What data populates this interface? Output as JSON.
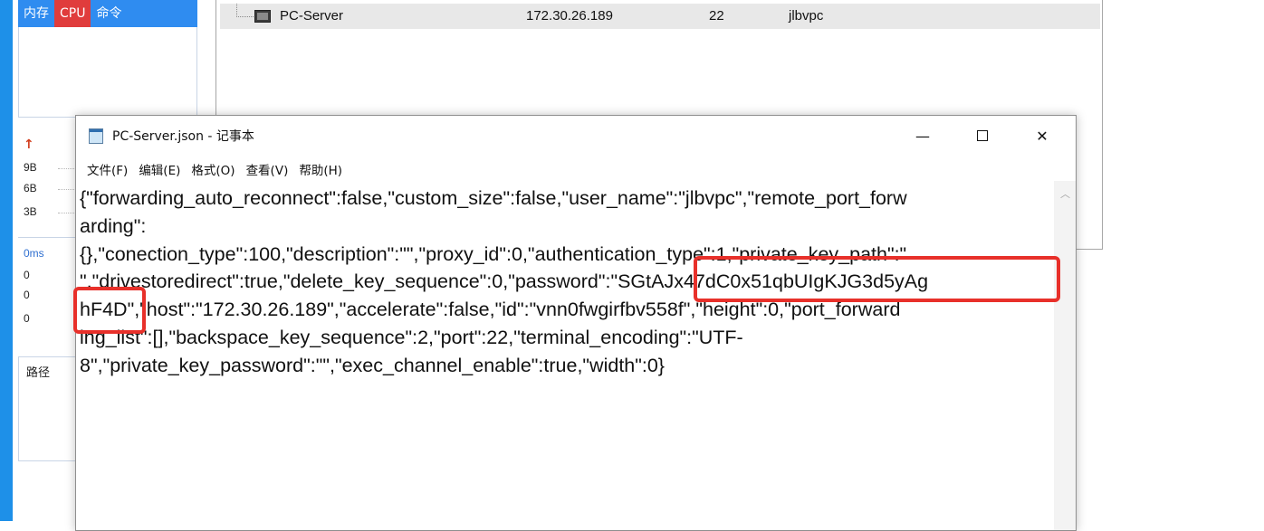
{
  "monitor": {
    "tabs": [
      "内存",
      "CPU",
      "命令"
    ],
    "active_tab": "CPU"
  },
  "network": {
    "labels": [
      "9B",
      "6B",
      "3B"
    ]
  },
  "ping": {
    "label": "0ms",
    "values": [
      "0",
      "0",
      "0"
    ]
  },
  "path": {
    "label": "路径"
  },
  "session": {
    "name": "PC-Server",
    "host": "172.30.26.189",
    "port": "22",
    "user": "jlbvpc"
  },
  "notepad": {
    "title": "PC-Server.json - 记事本",
    "menu": [
      "文件(F)",
      "编辑(E)",
      "格式(O)",
      "查看(V)",
      "帮助(H)"
    ],
    "content_lines": [
      "{\"forwarding_auto_reconnect\":false,\"custom_size\":false,\"user_name\":\"jlbvpc\",\"remote_port_forw",
      "arding\":",
      "{},\"conection_type\":100,\"description\":\"\",\"proxy_id\":0,\"authentication_type\":1,\"private_key_path\":\"",
      "\",\"drivestoredirect\":true,\"delete_key_sequence\":0,\"password\":\"SGtAJx47dC0x51qbUIgKJG3d5yAg",
      "hF4D\",\"host\":\"172.30.26.189\",\"accelerate\":false,\"id\":\"vnn0fwgirfbv558f\",\"height\":0,\"port_forward",
      "ing_list\":[],\"backspace_key_sequence\":2,\"port\":22,\"terminal_encoding\":\"UTF-",
      "8\",\"private_key_password\":\"\",\"exec_channel_enable\":true,\"width\":0}"
    ],
    "window_buttons": {
      "minimize": "—",
      "close": "✕"
    }
  },
  "annotation_color": "#e8302a",
  "accent_color": "#2f8cf0"
}
